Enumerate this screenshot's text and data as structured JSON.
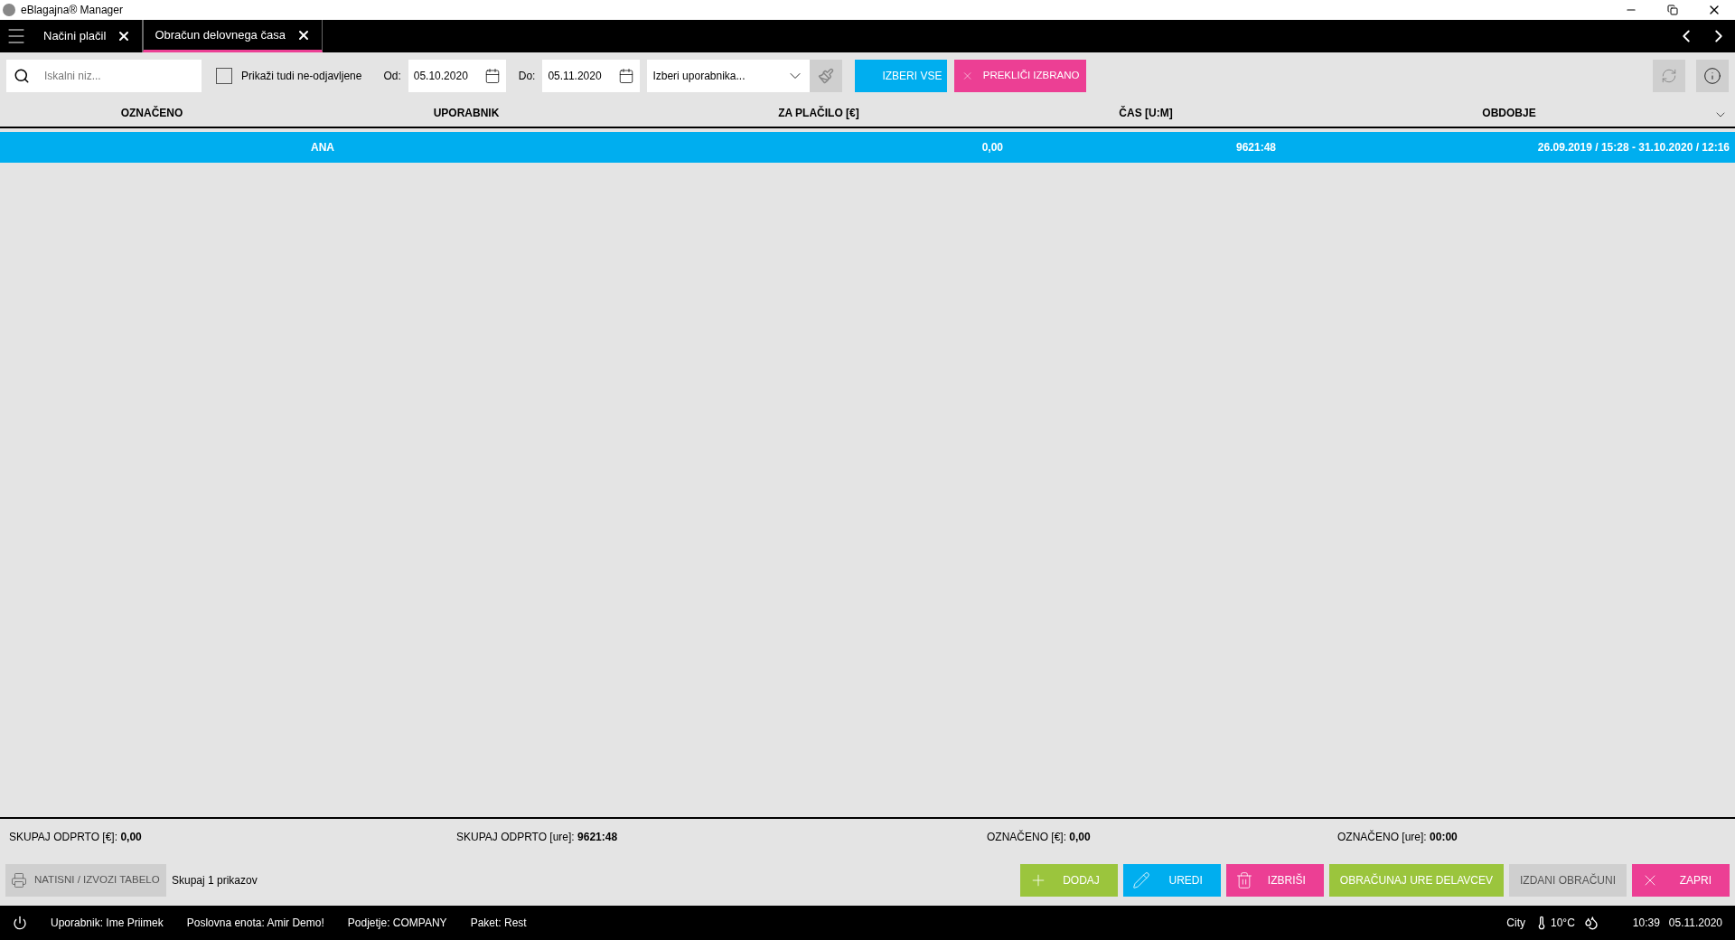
{
  "window": {
    "title": "eBlagajna® Manager"
  },
  "tabs": [
    {
      "label": "Načini plačil",
      "selected": false
    },
    {
      "label": "Obračun delovnega časa",
      "selected": true
    }
  ],
  "toolbar": {
    "search": {
      "placeholder": "Iskalni niz..."
    },
    "show_unregistered": {
      "label": "Prikaži tudi ne-odjavljene",
      "checked": false
    },
    "from": {
      "label": "Od:",
      "value": "05.10.2020"
    },
    "to": {
      "label": "Do:",
      "value": "05.11.2020"
    },
    "user_select": {
      "placeholder": "Izberi uporabnika..."
    },
    "select_all": "IZBERI VSE",
    "cancel_selection": "PREKLIČI IZBRANO"
  },
  "table": {
    "columns": [
      "OZNAČENO",
      "UPORABNIK",
      "ZA PLAČILO [€]",
      "ČAS [U:M]",
      "OBDOBJE"
    ],
    "rows": [
      {
        "user": "ANA",
        "payment": "0,00",
        "time": "9621:48",
        "period": "26.09.2019 / 15:28 - 31.10.2020 / 12:16",
        "selected": true
      }
    ]
  },
  "totals": [
    "SKUPAJ ODPRTO [€]: **0,00**",
    "SKUPAJ ODPRTO [ure]: **9621:48**",
    "OZNAČENO [€]: **0,00**",
    "OZNAČENO [ure]: **00:00**"
  ],
  "print_button": "NATISNI / IZVOZI TABELO",
  "count": "Skupaj 1 prikazov",
  "actions": [
    {
      "kind": "add",
      "label": "DODAJ"
    },
    {
      "kind": "edit",
      "label": "UREDI"
    },
    {
      "kind": "delete",
      "label": "IZBRIŠI"
    },
    {
      "kind": "calc",
      "label": "OBRAČUNAJ URE DELAVCEV"
    },
    {
      "kind": "issued",
      "label": "IZDANI OBRAČUNI"
    },
    {
      "kind": "close",
      "label": "ZAPRI"
    }
  ],
  "status_bar": {
    "items": [
      "Uporabnik: Ime Priimek",
      "Poslovna enota: Amir Demo!",
      "Podjetje: COMPANY",
      "Paket: Rest"
    ],
    "city": "City",
    "temperature": "10°C",
    "clock": "10:39",
    "date": "05.11.2020"
  }
}
